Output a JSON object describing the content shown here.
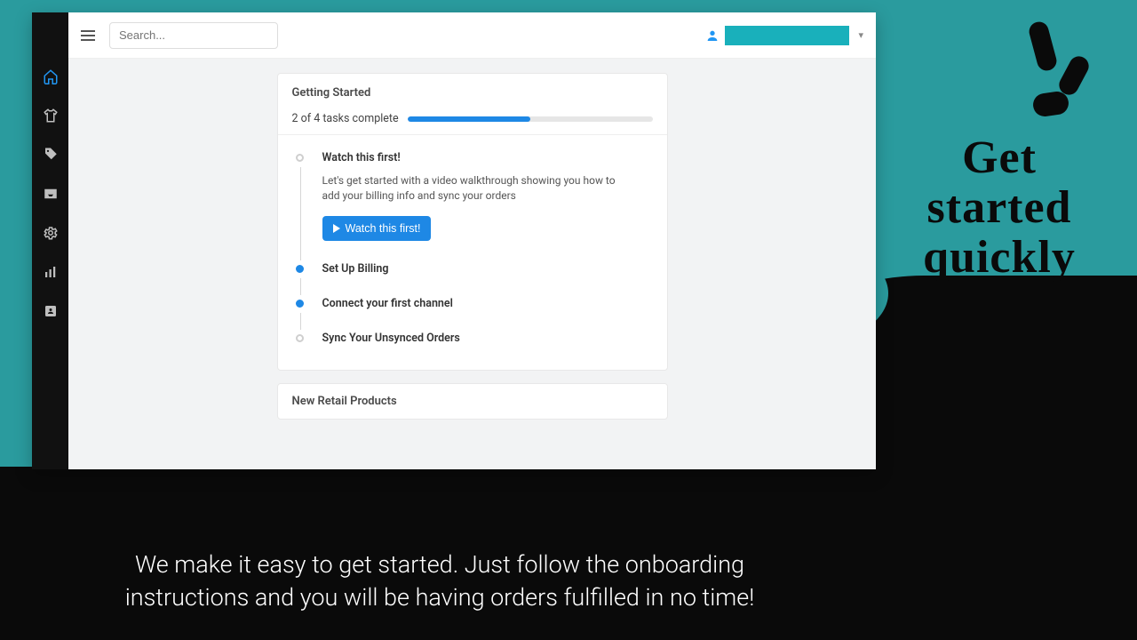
{
  "marketing": {
    "headline": "Get started quickly",
    "caption": "We make it easy to get started. Just follow the onboarding instructions and you will be having orders fulfilled in no time!"
  },
  "search": {
    "placeholder": "Search..."
  },
  "card1": {
    "title": "Getting Started",
    "progress_text": "2 of 4 tasks complete",
    "progress_pct": 50
  },
  "tasks": [
    {
      "title": "Watch this first!",
      "done": false,
      "desc": "Let's get started with a video walkthrough showing you how to add your billing info and sync your orders",
      "button": "Watch this first!"
    },
    {
      "title": "Set Up Billing",
      "done": true
    },
    {
      "title": "Connect your first channel",
      "done": true
    },
    {
      "title": "Sync Your Unsynced Orders",
      "done": false
    }
  ],
  "card2": {
    "title": "New Retail Products"
  }
}
